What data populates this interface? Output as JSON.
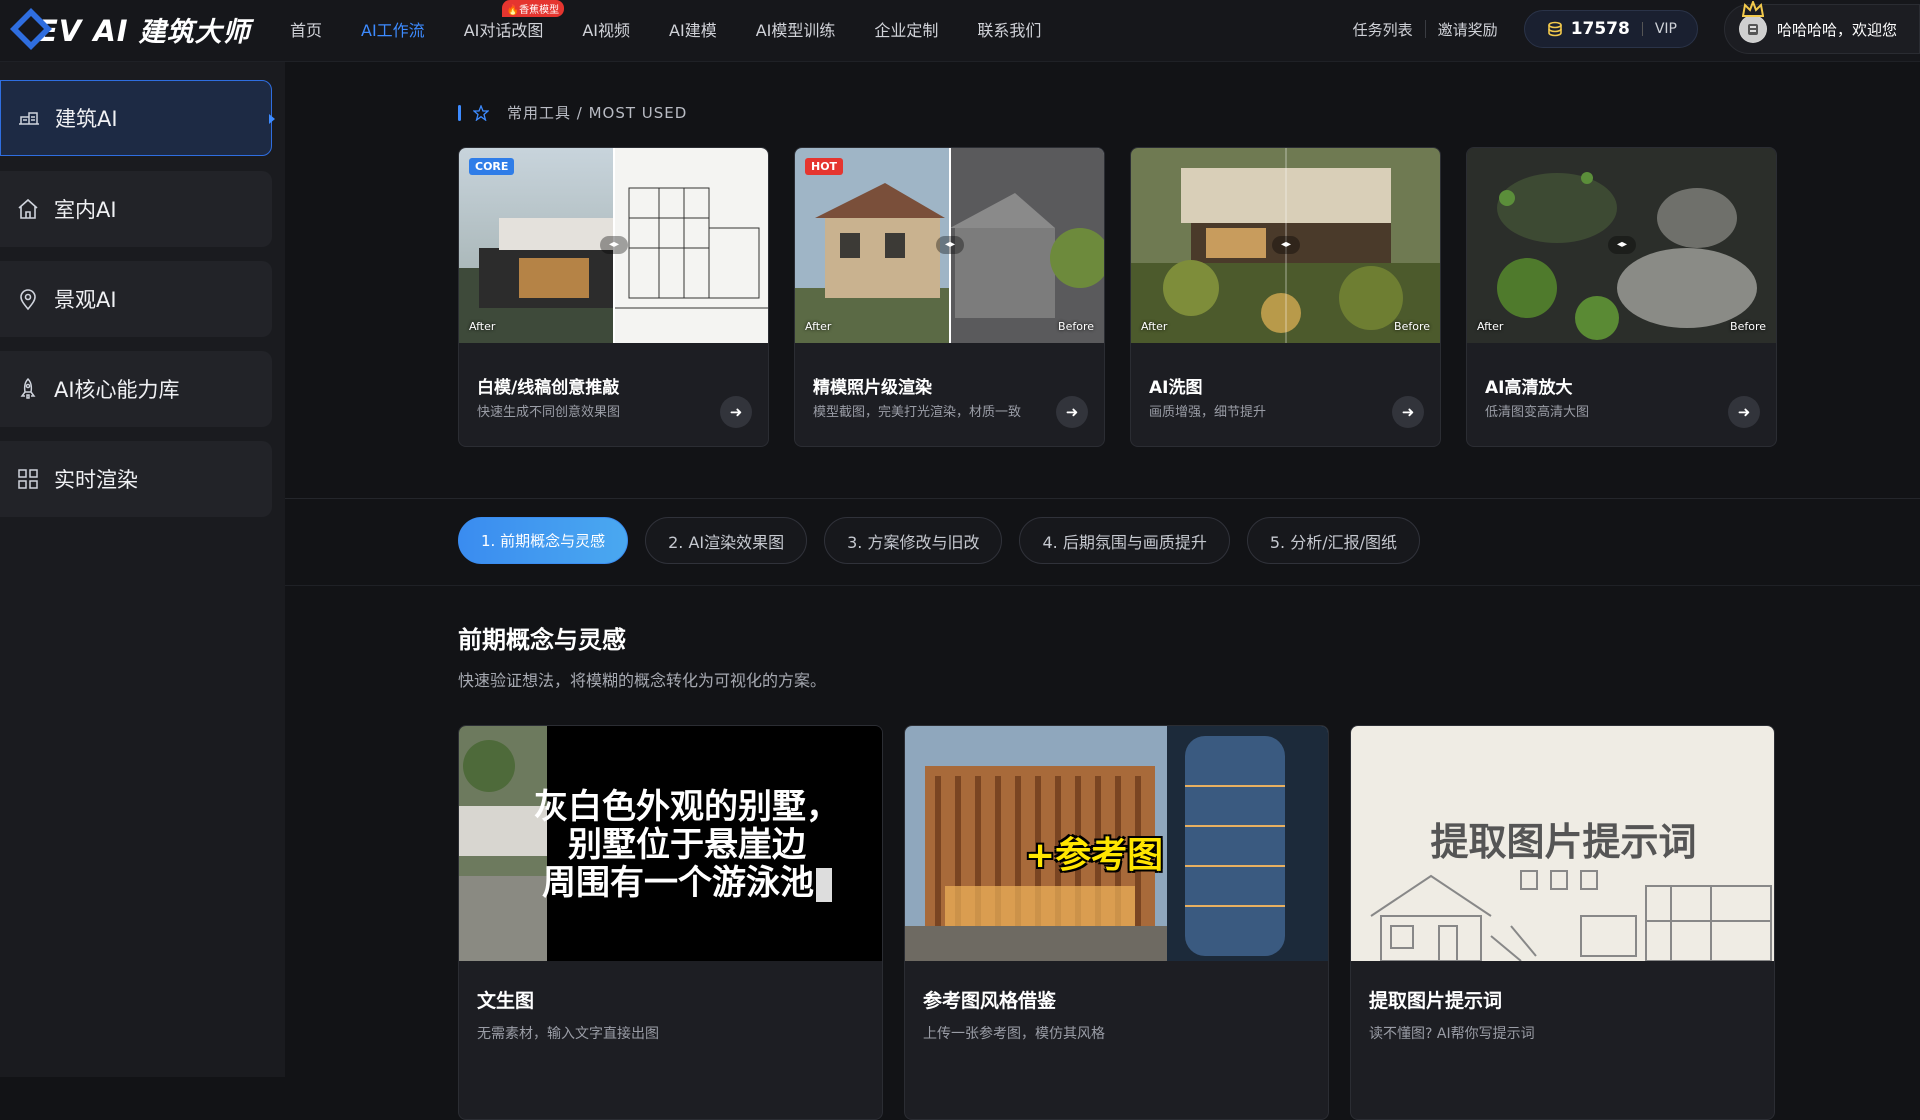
{
  "brand": {
    "name": "EV AI",
    "name_zh": "建筑大师",
    "accent": "#3d8bff"
  },
  "nav": {
    "items": [
      {
        "label": "首页"
      },
      {
        "label": "AI工作流"
      },
      {
        "label": "AI对话改图",
        "badge": "🔥香蕉模型"
      },
      {
        "label": "AI视频"
      },
      {
        "label": "AI建模"
      },
      {
        "label": "AI模型训练"
      },
      {
        "label": "企业定制"
      },
      {
        "label": "联系我们"
      }
    ]
  },
  "header": {
    "task_list": "任务列表",
    "invite": "邀请奖励",
    "credits": "17578",
    "vip": "VIP",
    "greeting": "哈哈哈哈，欢迎您"
  },
  "sidebar": {
    "items": [
      {
        "label": "建筑AI",
        "icon": "building-icon"
      },
      {
        "label": "室内AI",
        "icon": "home-icon"
      },
      {
        "label": "景观AI",
        "icon": "location-pin-icon"
      },
      {
        "label": "AI核心能力库",
        "icon": "rocket-icon"
      },
      {
        "label": "实时渲染",
        "icon": "grid-icon"
      }
    ]
  },
  "most_used": {
    "title": "常用工具 / MOST USED",
    "cards": [
      {
        "title": "白模/线稿创意推敲",
        "desc": "快速生成不同创意效果图",
        "badge": "CORE",
        "badge_color": "#2f7de8",
        "after": "After",
        "before": ""
      },
      {
        "title": "精模照片级渲染",
        "desc": "模型截图，完美打光渲染，材质一致",
        "badge": "HOT",
        "badge_color": "#e5352f",
        "after": "After",
        "before": "Before"
      },
      {
        "title": "AI洗图",
        "desc": "画质增强，细节提升",
        "badge": "",
        "badge_color": "",
        "after": "After",
        "before": "Before"
      },
      {
        "title": "AI高清放大",
        "desc": "低清图变高清大图",
        "badge": "",
        "badge_color": "",
        "after": "After",
        "before": "Before"
      }
    ]
  },
  "workflow_tabs": [
    {
      "label": "1. 前期概念与灵感"
    },
    {
      "label": "2. AI渲染效果图"
    },
    {
      "label": "3. 方案修改与旧改"
    },
    {
      "label": "4. 后期氛围与画质提升"
    },
    {
      "label": "5. 分析/汇报/图纸"
    }
  ],
  "category": {
    "title": "前期概念与灵感",
    "desc": "快速验证想法，将模糊的概念转化为可视化的方案。",
    "cards": [
      {
        "title": "文生图",
        "desc": "无需素材，输入文字直接出图",
        "overlay_lines": [
          "灰白色外观的别墅，",
          "别墅位于悬崖边",
          "周围有一个游泳池"
        ]
      },
      {
        "title": "参考图风格借鉴",
        "desc": "上传一张参考图，模仿其风格",
        "overlay": "+参考图"
      },
      {
        "title": "提取图片提示词",
        "desc": "读不懂图? AI帮你写提示词",
        "overlay": "提取图片提示词"
      }
    ]
  }
}
